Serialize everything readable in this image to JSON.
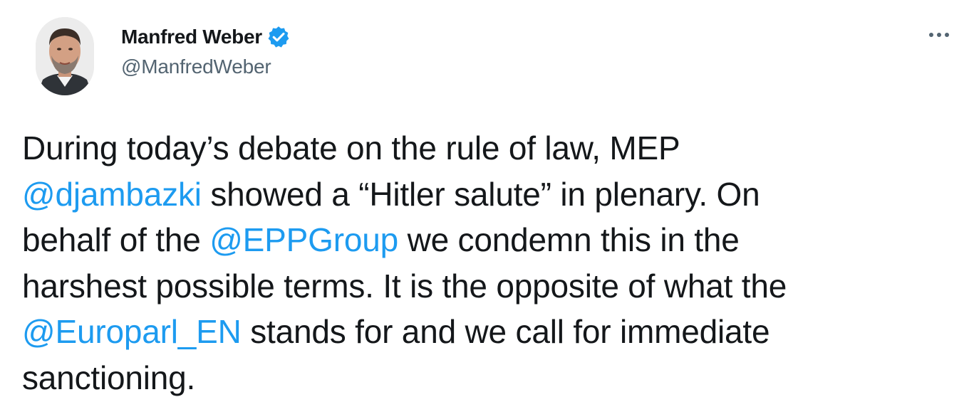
{
  "author": {
    "display_name": "Manfred Weber",
    "handle": "@ManfredWeber",
    "verified": true
  },
  "menu_icon": "more-options-icon",
  "tweet": {
    "lines": [
      [
        {
          "type": "text",
          "value": "During today’s debate on the rule of law, MEP"
        }
      ],
      [
        {
          "type": "mention",
          "value": "@djambazki"
        },
        {
          "type": "text",
          "value": " showed a “Hitler salute” in plenary. On"
        }
      ],
      [
        {
          "type": "text",
          "value": "behalf of the "
        },
        {
          "type": "mention",
          "value": "@EPPGroup"
        },
        {
          "type": "text",
          "value": " we condemn this in the"
        }
      ],
      [
        {
          "type": "text",
          "value": "harshest possible terms. It is the opposite of what the"
        }
      ],
      [
        {
          "type": "mention",
          "value": "@Europarl_EN"
        },
        {
          "type": "text",
          "value": " stands for and we call for immediate"
        }
      ],
      [
        {
          "type": "text",
          "value": "sanctioning."
        }
      ]
    ]
  },
  "colors": {
    "text": "#14171a",
    "secondary": "#536471",
    "mention": "#1d9bf0",
    "verified_badge": "#1d9bf0"
  }
}
